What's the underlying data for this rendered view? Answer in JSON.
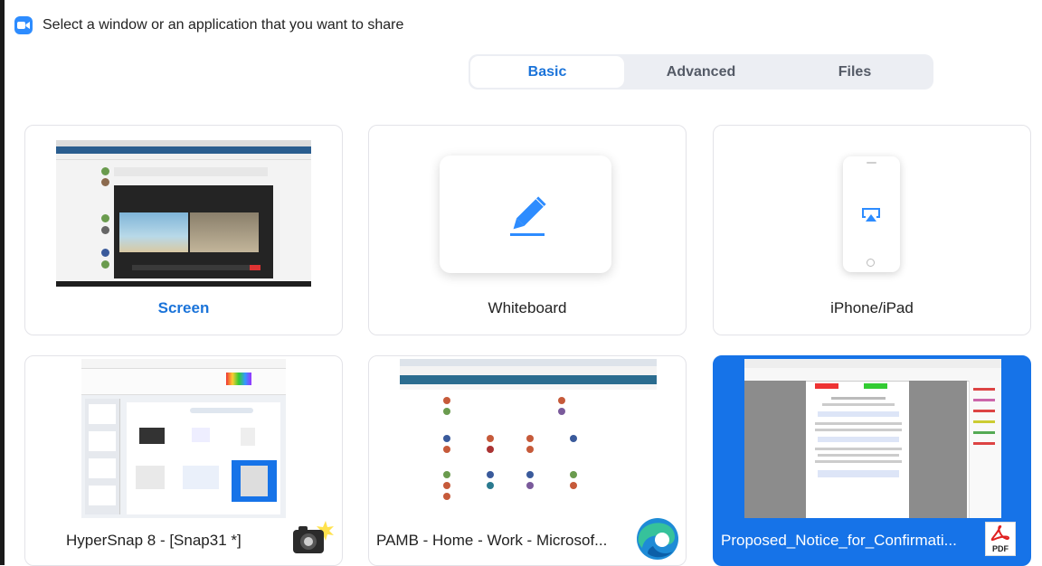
{
  "title": "Select a window or an application that you want to share",
  "tabs": [
    {
      "label": "Basic",
      "active": true
    },
    {
      "label": "Advanced",
      "active": false
    },
    {
      "label": "Files",
      "active": false
    }
  ],
  "basic_tiles": [
    {
      "label": "Screen",
      "highlight": true,
      "icon": "screen-thumbnail"
    },
    {
      "label": "Whiteboard",
      "highlight": false,
      "icon": "pen-icon"
    },
    {
      "label": "iPhone/iPad",
      "highlight": false,
      "icon": "airplay-icon"
    }
  ],
  "windows": [
    {
      "label": "HyperSnap 8 - [Snap31 *]",
      "app_icon": "hypersnap-camera-icon",
      "selected": false
    },
    {
      "label": "PAMB - Home - Work - Microsof...",
      "app_icon": "edge-browser-icon",
      "selected": false
    },
    {
      "label": "Proposed_Notice_for_Confirmati...",
      "app_icon": "pdf-icon",
      "selected": true
    }
  ],
  "pdf_badge": "PDF",
  "colors": {
    "accent": "#2d8cff",
    "selected_tile": "#1673e8",
    "tab_bg": "#eceef3",
    "active_tab_text": "#1a73d9"
  }
}
